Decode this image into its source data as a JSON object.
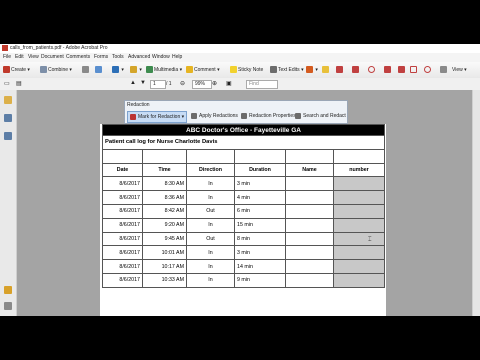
{
  "window": {
    "title": "calls_from_patients.pdf - Adobe Acrobat Pro"
  },
  "menu": [
    "File",
    "Edit",
    "View",
    "Document",
    "Comments",
    "Forms",
    "Tools",
    "Advanced",
    "Window",
    "Help"
  ],
  "toolbar": {
    "create": "Create",
    "combine": "Combine",
    "multimedia": "Multimedia",
    "comment": "Comment",
    "sticky_note": "Sticky Note",
    "text_edits": "Text Edits",
    "view": "View"
  },
  "toolbar2": {
    "page_current": "1",
    "page_total": "/ 1",
    "zoom": "99%",
    "find_placeholder": "Find"
  },
  "redaction_panel": {
    "title": "Redaction",
    "buttons": [
      "Mark for Redaction",
      "Apply Redactions",
      "Redaction Properties",
      "Search and Redact"
    ]
  },
  "document": {
    "title": "ABC Doctor's Office - Fayetteville GA",
    "subtitle": "Patient call log for Nurse Charlotte Davis",
    "columns": [
      "Date",
      "Time",
      "Direction",
      "Duration",
      "Name",
      "number"
    ],
    "rows": [
      [
        "8/6/2017",
        "8:30 AM",
        "In",
        "3 min",
        "",
        ""
      ],
      [
        "8/6/2017",
        "8:36 AM",
        "In",
        "4 min",
        "",
        ""
      ],
      [
        "8/6/2017",
        "8:42 AM",
        "Out",
        "6 min",
        "",
        ""
      ],
      [
        "8/6/2017",
        "9:20 AM",
        "In",
        "15 min",
        "",
        ""
      ],
      [
        "8/6/2017",
        "9:45 AM",
        "Out",
        "8 min",
        "",
        ""
      ],
      [
        "8/6/2017",
        "10:01 AM",
        "In",
        "3 min",
        "",
        ""
      ],
      [
        "8/6/2017",
        "10:17 AM",
        "In",
        "14 min",
        "",
        ""
      ],
      [
        "8/6/2017",
        "10:33 AM",
        "In",
        "9 min",
        "",
        ""
      ]
    ]
  },
  "colors": {
    "redaction_fill": "#c8c8c8",
    "header_bg": "#000000",
    "doc_bg": "#a4a4a4"
  }
}
